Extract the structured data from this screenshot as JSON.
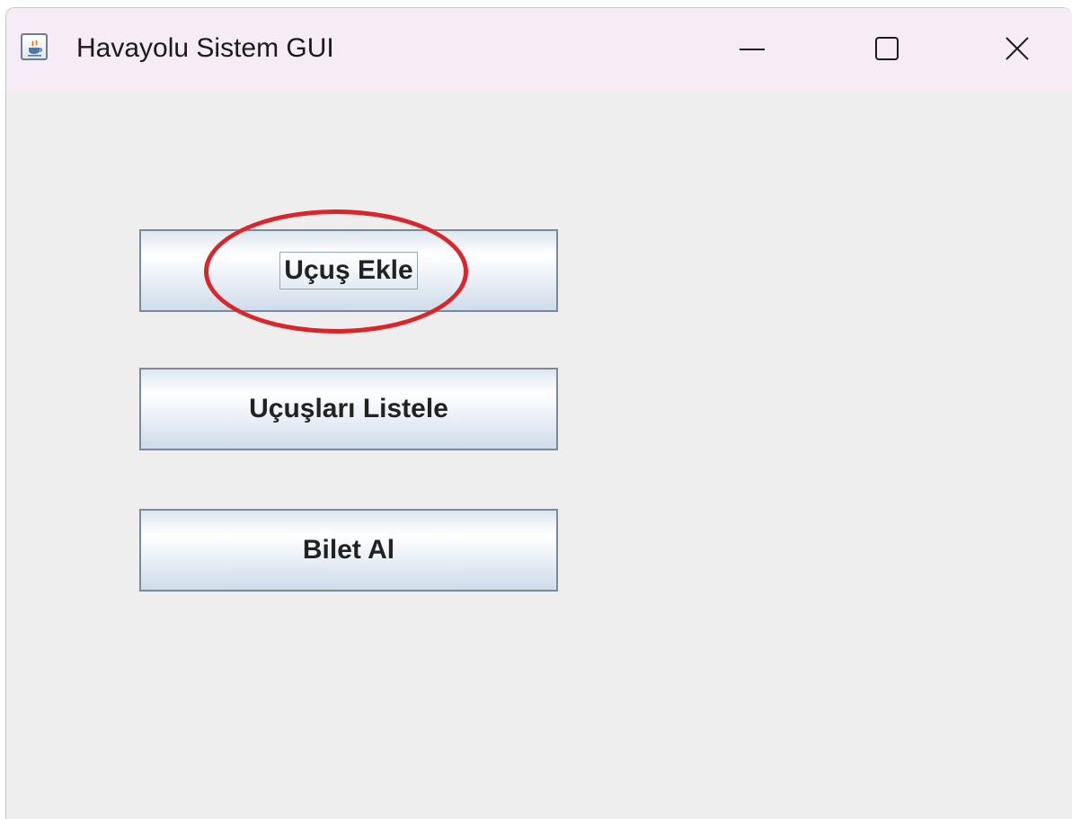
{
  "window": {
    "title": "Havayolu Sistem GUI",
    "app_icon": "java-icon",
    "controls": {
      "minimize_icon": "minimize-icon",
      "maximize_icon": "maximize-icon",
      "close_icon": "close-icon"
    }
  },
  "buttons": {
    "add_flight": "Uçuş Ekle",
    "list_flights": "Uçuşları Listele",
    "buy_ticket": "Bilet Al"
  },
  "annotation": {
    "shape": "ellipse",
    "color": "#d9262b",
    "target": "add_flight"
  }
}
